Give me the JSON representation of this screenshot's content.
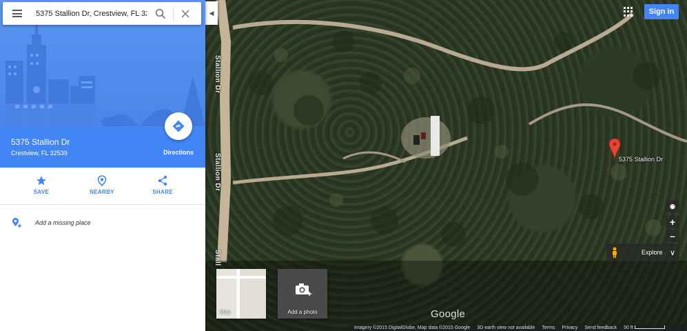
{
  "search": {
    "query": "5375 Stallion Dr, Crestview, FL 32"
  },
  "place": {
    "title": "5375 Stallion Dr",
    "subtitle": "Crestview, FL 32539",
    "directions_label": "Directions"
  },
  "actions": [
    {
      "label": "SAVE",
      "icon": "star-icon"
    },
    {
      "label": "NEARBY",
      "icon": "nearby-icon"
    },
    {
      "label": "SHARE",
      "icon": "share-icon"
    }
  ],
  "add_missing_place": "Add a missing place",
  "map": {
    "pin_label": "5375 Stallion Dr",
    "street_labels": [
      "Stallion Dr",
      "Stallion Dr",
      "Stall"
    ],
    "signin_label": "Sign in",
    "explore_label": "Explore",
    "thumb_map_label": "Map",
    "thumb_photo_label": "Add a photo",
    "google_logo": "Google",
    "footer": {
      "imagery": "Imagery ©2015 DigitalGlobe, Map data ©2015 Google",
      "earth_view": "3D earth view not available",
      "terms": "Terms",
      "privacy": "Privacy",
      "feedback": "Send feedback",
      "scale": "50 ft"
    }
  },
  "colors": {
    "accent": "#4285f4",
    "pin": "#ea4335",
    "hero_bg": "#5b95f0"
  }
}
